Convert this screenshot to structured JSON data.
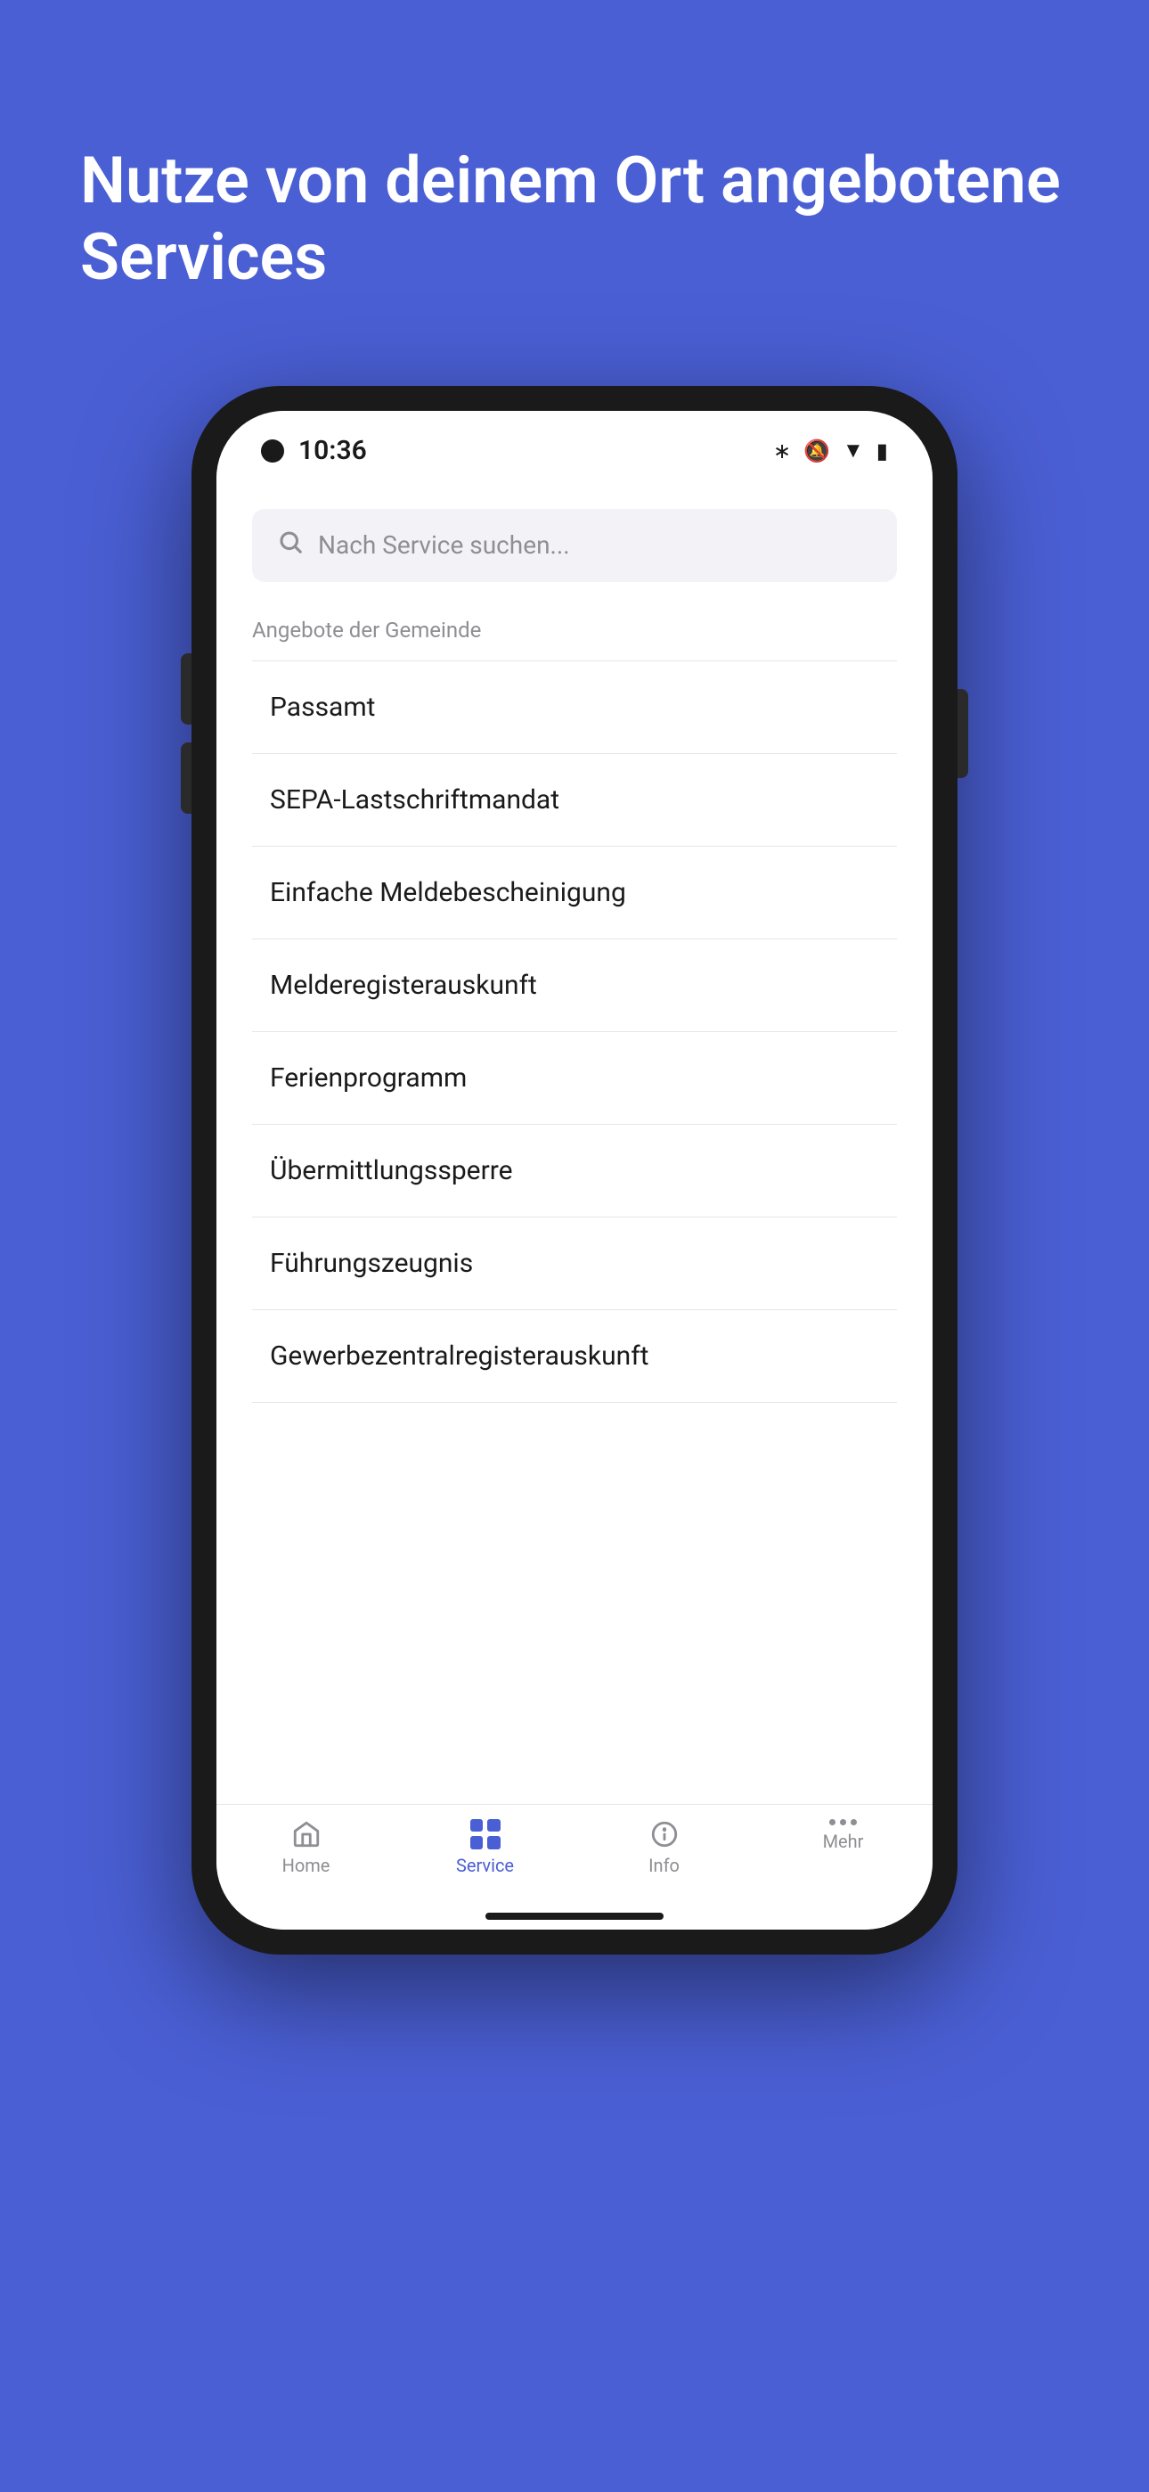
{
  "page": {
    "background_color": "#4a5fd4"
  },
  "hero": {
    "title": "Nutze von deinem Ort angebotene Services"
  },
  "status_bar": {
    "time": "10:36",
    "icons": [
      "bluetooth",
      "bell-off",
      "wifi",
      "battery"
    ]
  },
  "search": {
    "placeholder": "Nach Service suchen..."
  },
  "section": {
    "title": "Angebote der Gemeinde"
  },
  "services": [
    {
      "name": "Passamt"
    },
    {
      "name": "SEPA-Lastschriftmandat"
    },
    {
      "name": "Einfache Meldebescheinigung"
    },
    {
      "name": "Melderegisterauskunft"
    },
    {
      "name": "Ferienprogramm"
    },
    {
      "name": "Übermittlungssperre"
    },
    {
      "name": "Führungszeugnis"
    },
    {
      "name": "Gewerbezentralregisterauskunft"
    }
  ],
  "bottom_nav": {
    "items": [
      {
        "label": "Home",
        "icon": "home",
        "active": false
      },
      {
        "label": "Service",
        "icon": "grid",
        "active": true
      },
      {
        "label": "Info",
        "icon": "info",
        "active": false
      },
      {
        "label": "Mehr",
        "icon": "more",
        "active": false
      }
    ]
  }
}
